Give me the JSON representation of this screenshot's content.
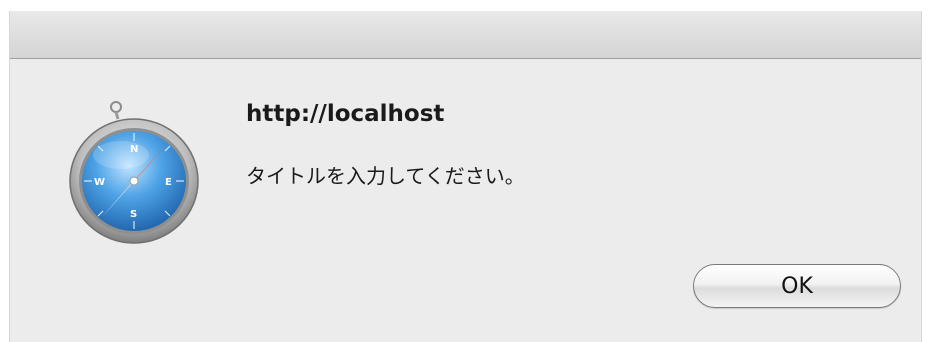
{
  "dialog": {
    "title": "http://localhost",
    "message": "タイトルを入力してください。",
    "ok_label": "OK",
    "icon": "safari-compass-icon"
  },
  "colors": {
    "dialog_bg": "#ececec",
    "titlebar_bg": "#dcdcdc",
    "compass_blue": "#3b8fd6",
    "needle_red": "#e04a2c"
  }
}
